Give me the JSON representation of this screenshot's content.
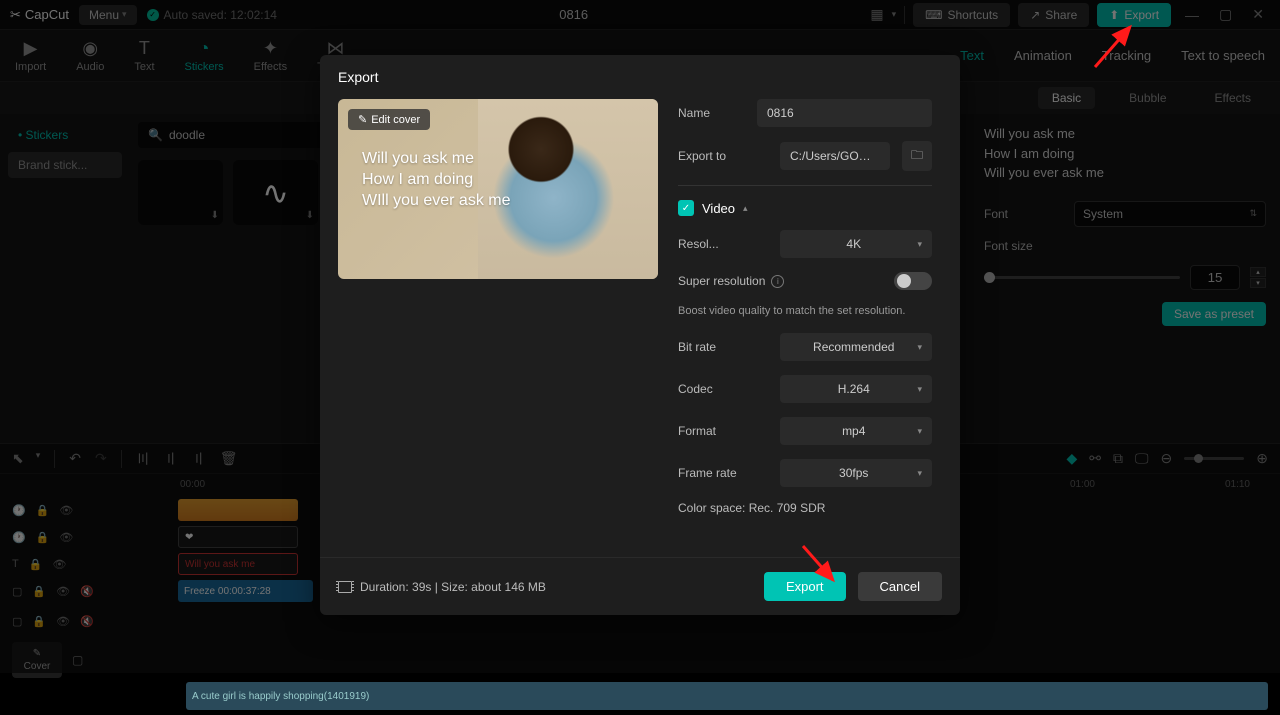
{
  "topbar": {
    "appName": "CapCut",
    "menu": "Menu",
    "autosave": "Auto saved: 12:02:14",
    "projectTitle": "0816",
    "shortcuts": "Shortcuts",
    "share": "Share",
    "export": "Export"
  },
  "tools": {
    "import": "Import",
    "audio": "Audio",
    "text": "Text",
    "stickers": "Stickers",
    "effects": "Effects",
    "trans": "Trans..."
  },
  "rightTabs": {
    "text": "Text",
    "animation": "Animation",
    "tracking": "Tracking",
    "tts": "Text to speech"
  },
  "subTabs": {
    "basic": "Basic",
    "bubble": "Bubble",
    "effects": "Effects"
  },
  "sidebar": {
    "stickers": "Stickers",
    "brand": "Brand stick..."
  },
  "search": {
    "value": "doodle"
  },
  "textPanel": {
    "line1": "Will you ask me",
    "line2": "How I am doing",
    "line3": "Will you ever ask me",
    "fontLabel": "Font",
    "fontValue": "System",
    "fontsizeLabel": "Font size",
    "fontsizeValue": "15",
    "savePreset": "Save as preset"
  },
  "timeline": {
    "times": [
      "00:00",
      "01:00",
      "01:10"
    ],
    "textClip": "Will you ask me",
    "freezeClip": "Freeze   00:00:37:28",
    "audioClip": "A cute girl is happily shopping(1401919)",
    "cover": "Cover"
  },
  "modal": {
    "title": "Export",
    "editCover": "Edit cover",
    "coverText1": "Will you ask me",
    "coverText2": "How I am doing",
    "coverText3": "WIll you ever ask me",
    "nameLabel": "Name",
    "nameValue": "0816",
    "exportToLabel": "Export to",
    "exportToValue": "C:/Users/GOOD WILL ...",
    "videoSection": "Video",
    "resolLabel": "Resol...",
    "resolValue": "4K",
    "superResLabel": "Super resolution",
    "superResHelp": "Boost video quality to match the set resolution.",
    "bitrateLabel": "Bit rate",
    "bitrateValue": "Recommended",
    "codecLabel": "Codec",
    "codecValue": "H.264",
    "formatLabel": "Format",
    "formatValue": "mp4",
    "framerateLabel": "Frame rate",
    "framerateValue": "30fps",
    "colorspace": "Color space: Rec. 709 SDR",
    "duration": "Duration: 39s | Size: about 146 MB",
    "exportBtn": "Export",
    "cancelBtn": "Cancel"
  }
}
